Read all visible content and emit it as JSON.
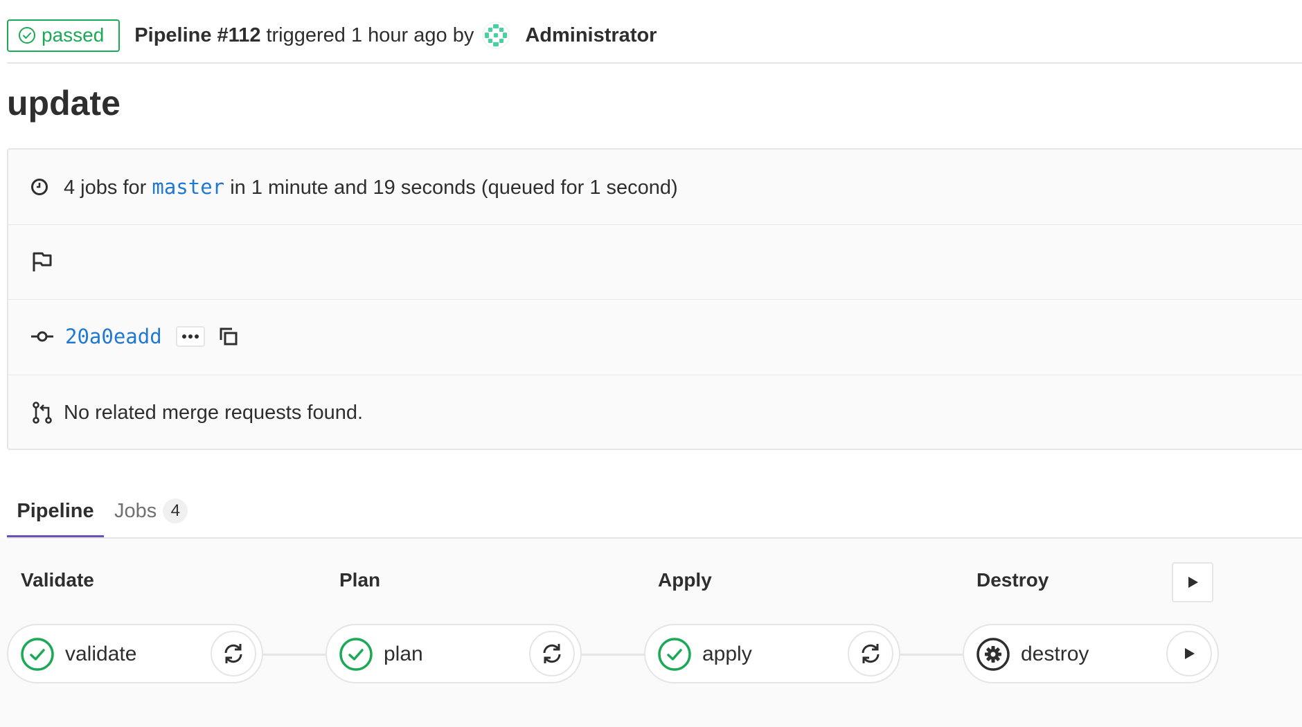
{
  "header": {
    "status_label": "passed",
    "pipeline_id": "Pipeline #112",
    "triggered_text": "triggered 1 hour ago by",
    "user_name": "Administrator"
  },
  "title": "update",
  "info": {
    "jobs_prefix": "4 jobs for",
    "branch": "master",
    "duration_text": "in 1 minute and 19 seconds (queued for 1 second)",
    "commit_sha": "20a0eadd",
    "merge_requests_text": "No related merge requests found."
  },
  "tabs": {
    "pipeline_label": "Pipeline",
    "jobs_label": "Jobs",
    "jobs_count": "4"
  },
  "stages": [
    {
      "title": "Validate",
      "job": "validate",
      "status": "success",
      "action": "retry"
    },
    {
      "title": "Plan",
      "job": "plan",
      "status": "success",
      "action": "retry"
    },
    {
      "title": "Apply",
      "job": "apply",
      "status": "success",
      "action": "retry"
    },
    {
      "title": "Destroy",
      "job": "destroy",
      "status": "manual",
      "action": "play"
    }
  ],
  "colors": {
    "success": "#1aaa55",
    "link": "#1f78d1",
    "active_tab": "#6b4fbb",
    "border": "#e5e5e5"
  }
}
